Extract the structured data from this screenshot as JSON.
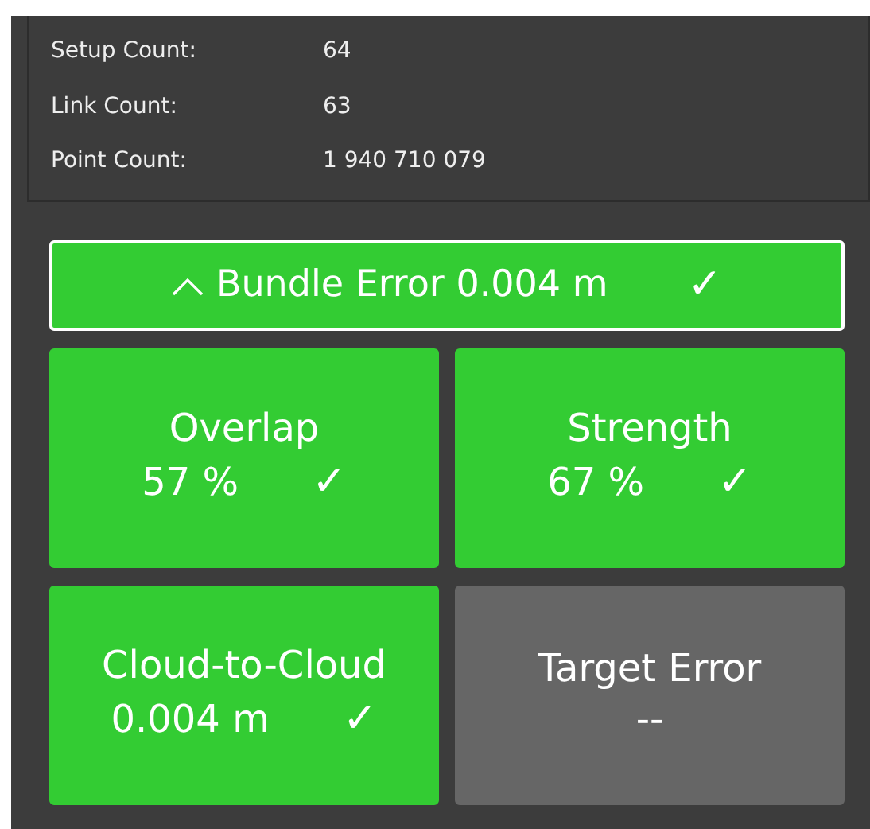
{
  "stats": [
    {
      "label": "Setup Count:",
      "value": "64"
    },
    {
      "label": "Link Count:",
      "value": "63"
    },
    {
      "label": "Point Count:",
      "value": "1 940 710 079"
    }
  ],
  "bundle": {
    "label": "Bundle Error 0.004 m",
    "expanded": true,
    "color": "#33cc33",
    "check": "✓"
  },
  "tiles": [
    {
      "title": "Overlap",
      "value": "57 %",
      "color": "#33cc33",
      "check": "✓"
    },
    {
      "title": "Strength",
      "value": "67 %",
      "color": "#33cc33",
      "check": "✓"
    },
    {
      "title": "Cloud-to-Cloud",
      "value": "0.004 m",
      "color": "#33cc33",
      "check": "✓"
    },
    {
      "title": "Target Error",
      "value": "--",
      "color": "#666666"
    }
  ]
}
